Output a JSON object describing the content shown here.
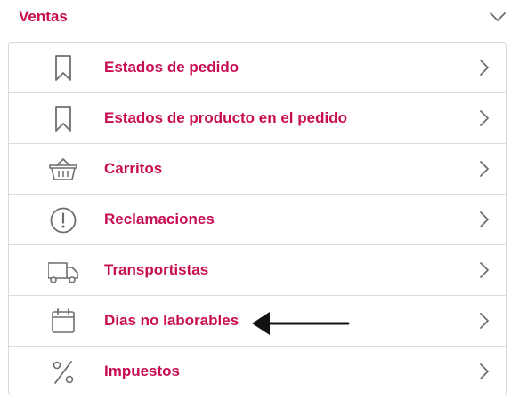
{
  "colors": {
    "accent": "#c80e52",
    "icon": "#6e6e6e",
    "arrow": "#111111"
  },
  "section": {
    "title": "Ventas",
    "toggle_icon": "chevron-down-icon"
  },
  "items": [
    {
      "label": "Estados de pedido",
      "icon": "bookmark-icon"
    },
    {
      "label": "Estados de producto en el pedido",
      "icon": "bookmark-icon"
    },
    {
      "label": "Carritos",
      "icon": "basket-icon"
    },
    {
      "label": "Reclamaciones",
      "icon": "alert-circle-icon"
    },
    {
      "label": "Transportistas",
      "icon": "truck-icon"
    },
    {
      "label": "Días no laborables",
      "icon": "calendar-icon"
    },
    {
      "label": "Impuestos",
      "icon": "percent-icon"
    }
  ],
  "annotation": {
    "icon": "left-arrow-icon"
  }
}
